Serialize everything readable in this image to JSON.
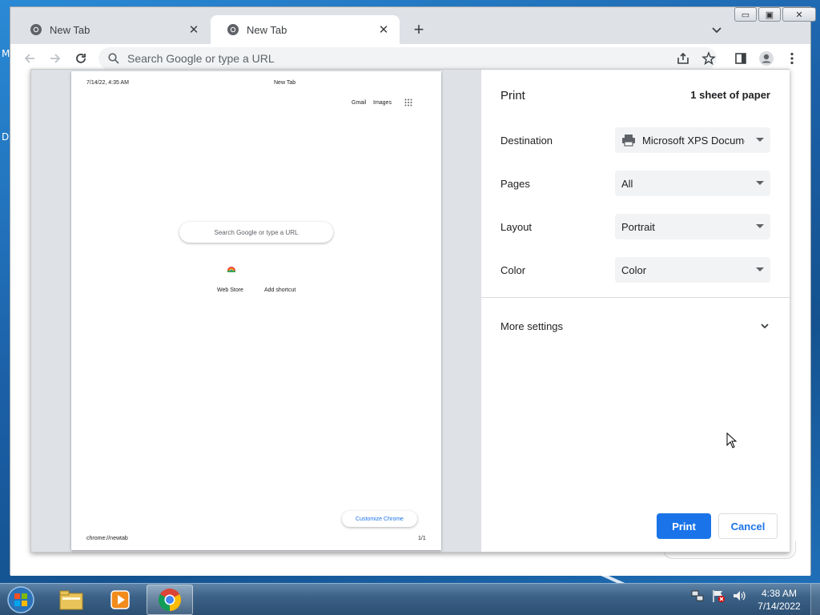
{
  "desktop": {
    "left_letters": [
      "M",
      "D"
    ]
  },
  "browser": {
    "tabs": [
      {
        "title": "New Tab",
        "active": false
      },
      {
        "title": "New Tab",
        "active": true
      }
    ],
    "new_tab_symbol": "+",
    "close_symbol": "✕",
    "window_controls": {
      "minimize": "▭",
      "maximize": "▣",
      "close": "✕"
    },
    "omnibox": {
      "placeholder": "Search Google or type a URL"
    }
  },
  "print_dialog": {
    "title": "Print",
    "sheets": "1 sheet of paper",
    "rows": [
      {
        "label": "Destination",
        "value": "Microsoft XPS Document Writer",
        "icon": "printer-icon"
      },
      {
        "label": "Pages",
        "value": "All"
      },
      {
        "label": "Layout",
        "value": "Portrait"
      },
      {
        "label": "Color",
        "value": "Color"
      }
    ],
    "more_settings": "More settings",
    "print_button": "Print",
    "cancel_button": "Cancel",
    "preview": {
      "header_date": "7/14/22, 4:35 AM",
      "header_title": "New Tab",
      "gmail": "Gmail",
      "images": "Images",
      "search_placeholder": "Search Google or type a URL",
      "shortcut_webstore": "Web Store",
      "shortcut_add": "Add shortcut",
      "customize": "Customize Chrome",
      "footer_url": "chrome://newtab",
      "footer_page": "1/1"
    }
  },
  "taskbar": {
    "apps": [
      "start-orb",
      "file-explorer",
      "media-player",
      "chrome"
    ],
    "clock": {
      "time": "4:38 AM",
      "date": "7/14/2022"
    }
  },
  "colors": {
    "accent": "#1a73e8",
    "taskbar": "#3c6287",
    "chrome_frame": "#dee1e6"
  }
}
